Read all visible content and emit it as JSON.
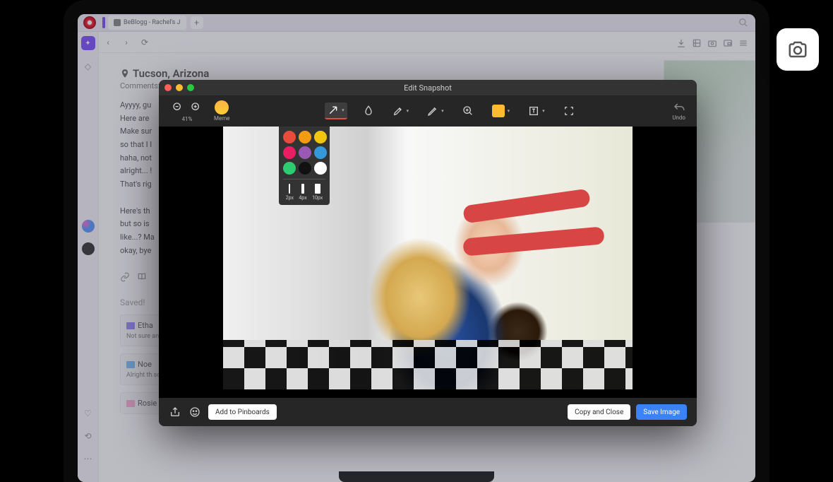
{
  "browser": {
    "tab_title": "BeBlogg - Rachel's J",
    "new_tab_glyph": "+"
  },
  "nav": {
    "back": "‹",
    "forward": "›",
    "reload": "⟳"
  },
  "page": {
    "location_text": "Tucson, Arizona",
    "comments_label": "Comments:",
    "post_body": "Ayyyy, gu\nHere are\nMake sur\nso that I l\nhaha, not\nalright... !\nThat's rig\n\nHere's th\nbut so is\nlike...? Ma\nokay, bye",
    "saved_label": "Saved!",
    "drafts": [
      {
        "title": "Etha",
        "snippet": "Not sure\nand I will",
        "icon": "folder-purple"
      },
      {
        "title": "Noe",
        "snippet": "Alright th\nsoooo, an",
        "icon": "folder-blue"
      },
      {
        "title": "Rosie",
        "snippet": "",
        "icon": "folder-pink"
      }
    ]
  },
  "snapshot": {
    "window_title": "Edit Snapshot",
    "zoom_label": "41%",
    "meme_label": "Meme",
    "undo_label": "Undo",
    "colors": [
      "#e74c3c",
      "#f39c12",
      "#f1c40f",
      "#e91e63",
      "#9b59b6",
      "#3498db",
      "#2ecc71",
      "#111111",
      "#ffffff"
    ],
    "sizes": [
      {
        "label": "2px",
        "w": 2,
        "h": 14
      },
      {
        "label": "4px",
        "w": 4,
        "h": 14
      },
      {
        "label": "10px",
        "w": 8,
        "h": 14
      }
    ],
    "bottom": {
      "pinboards": "Add to Pinboards",
      "copy_close": "Copy and Close",
      "save": "Save Image"
    }
  }
}
